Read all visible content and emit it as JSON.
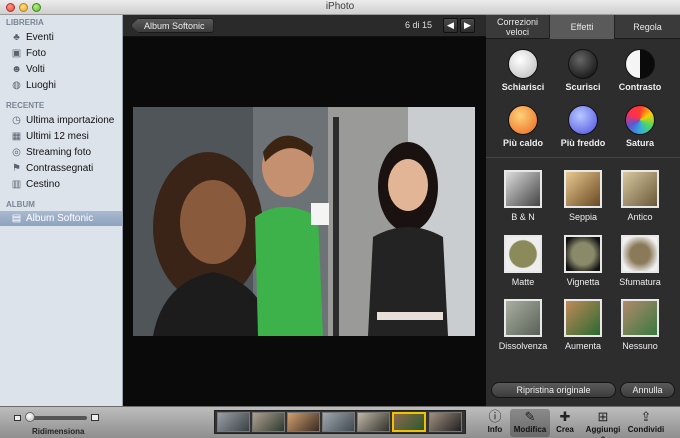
{
  "window": {
    "title": "iPhoto"
  },
  "sidebar": {
    "sections": [
      {
        "heading": "LIBRERIA",
        "items": [
          {
            "label": "Eventi",
            "icon": "palm-tree-icon"
          },
          {
            "label": "Foto",
            "icon": "photos-icon"
          },
          {
            "label": "Volti",
            "icon": "faces-icon"
          },
          {
            "label": "Luoghi",
            "icon": "globe-icon"
          }
        ]
      },
      {
        "heading": "RECENTE",
        "items": [
          {
            "label": "Ultima importazione",
            "icon": "clock-icon"
          },
          {
            "label": "Ultimi 12 mesi",
            "icon": "calendar-icon"
          },
          {
            "label": "Streaming foto",
            "icon": "photostream-icon"
          },
          {
            "label": "Contrassegnati",
            "icon": "flag-icon"
          },
          {
            "label": "Cestino",
            "icon": "trash-icon"
          }
        ]
      },
      {
        "heading": "ALBUM",
        "items": [
          {
            "label": "Album Softonic",
            "icon": "album-icon",
            "selected": true
          }
        ]
      }
    ]
  },
  "viewer": {
    "back_label": "Album Softonic",
    "counter": "6 di 15"
  },
  "panel": {
    "tabs": [
      "Correzioni veloci",
      "Effetti",
      "Regola"
    ],
    "active_tab": "Effetti",
    "effects": [
      "Schiarisci",
      "Scurisci",
      "Contrasto",
      "Più caldo",
      "Più freddo",
      "Satura"
    ],
    "filters": [
      "B & N",
      "Seppia",
      "Antico",
      "Matte",
      "Vignetta",
      "Sfumatura",
      "Dissolvenza",
      "Aumenta",
      "Nessuno"
    ],
    "reset_label": "Ripristina originale",
    "cancel_label": "Annulla"
  },
  "bottombar": {
    "resize_label": "Ridimensiona",
    "filmstrip_count": 7,
    "filmstrip_current": 5,
    "tools": [
      {
        "label": "Info",
        "icon": "info-icon"
      },
      {
        "label": "Modifica",
        "icon": "pencil-icon",
        "active": true
      },
      {
        "label": "Crea",
        "icon": "create-icon"
      },
      {
        "label": "Aggiungi a",
        "icon": "plus-icon"
      },
      {
        "label": "Condividi",
        "icon": "share-icon"
      }
    ]
  }
}
